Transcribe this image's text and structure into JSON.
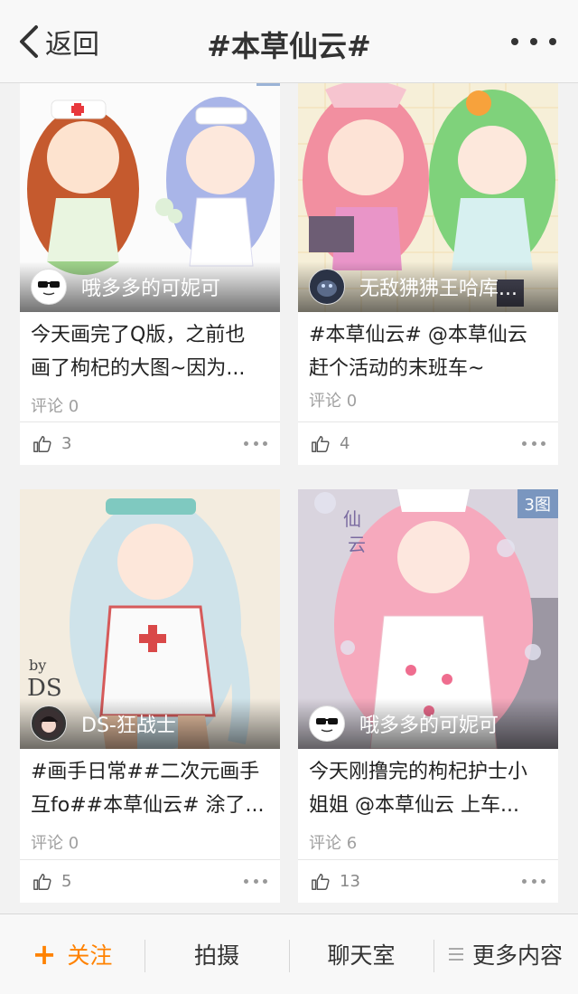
{
  "header": {
    "back_label": "返回",
    "title": "#本草仙云#"
  },
  "cards": [
    {
      "author": "哦多多的可妮可",
      "caption_line1": "今天画完了Q版，之前也",
      "caption_line2": "画了枸杞的大图~因为...",
      "comments": "评论 0",
      "likes": "3"
    },
    {
      "author": "无敌狒狒王哈库...",
      "caption_line1": "#本草仙云# @本草仙云",
      "caption_line2": "赶个活动的末班车~",
      "comments": "评论 0",
      "likes": "4"
    },
    {
      "author": "DS-狂战士",
      "caption_line1": "#画手日常##二次元画手",
      "caption_line2": "互fo##本草仙云# 涂了...",
      "comments": "评论 0",
      "likes": "5"
    },
    {
      "author": "哦多多的可妮可",
      "badge": "3图",
      "caption_line1": "今天刚撸完的枸杞护士小",
      "caption_line2": "姐姐 @本草仙云  上车...",
      "comments": "评论 6",
      "likes": "13"
    }
  ],
  "bottombar": {
    "follow_plus": "+",
    "follow_label": "关注",
    "shoot_label": "拍摄",
    "chat_label": "聊天室",
    "more_label": "更多内容"
  },
  "colors": {
    "accent": "#ff8200",
    "background": "#f2f2f2"
  }
}
